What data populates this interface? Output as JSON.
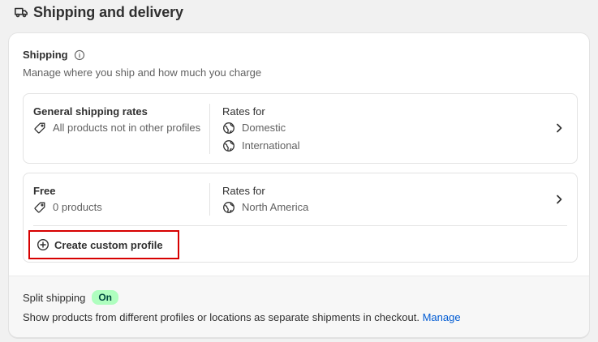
{
  "header": {
    "title": "Shipping and delivery",
    "icon": "truck-icon"
  },
  "shipping": {
    "title": "Shipping",
    "description": "Manage where you ship and how much you charge",
    "profiles": [
      {
        "name": "General shipping rates",
        "products_label": "All products not in other profiles",
        "rates_for_label": "Rates for",
        "zones": [
          "Domestic",
          "International"
        ]
      },
      {
        "name": "Free",
        "products_label": "0 products",
        "rates_for_label": "Rates for",
        "zones": [
          "North America"
        ]
      }
    ],
    "create_profile_label": "Create custom profile"
  },
  "split_shipping": {
    "title": "Split shipping",
    "status_badge": "On",
    "description": "Show products from different profiles or locations as separate shipments in checkout.",
    "manage_label": "Manage"
  },
  "colors": {
    "accent_link": "#005bd3",
    "badge_bg": "#affebf",
    "badge_text": "#014b40",
    "highlight_border": "#d70000"
  }
}
